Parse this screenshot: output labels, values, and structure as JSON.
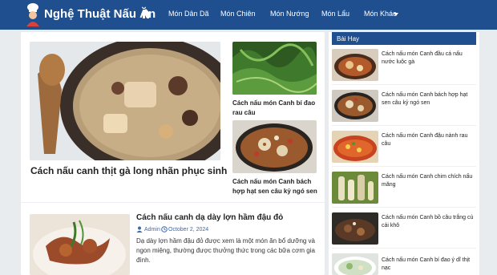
{
  "header": {
    "site_title": "Nghệ Thuật Nấu Ăn",
    "logo_icon": "chef-icon",
    "home_icon": "home-icon",
    "nav": [
      "Món Dân Dã",
      "Món Chiên",
      "Món Nướng",
      "Món Lẩu",
      "Món Khác"
    ],
    "colors": {
      "bar": "#1f4f8f",
      "text": "#ffffff"
    }
  },
  "main": {
    "featured": {
      "title": "Cách nấu canh thịt gà long nhãn phục sinh"
    },
    "side_posts": [
      {
        "title": "Cách nấu món Canh bí đao rau câu"
      },
      {
        "title": "Cách nấu món Canh bách hợp hạt sen câu kỷ ngó sen"
      }
    ],
    "post": {
      "title": "Cách nấu canh dạ dày lợn hầm đậu đỏ",
      "author": "Admin",
      "date": "October 2, 2024",
      "excerpt": "Dạ dày lợn hầm đậu đỏ được xem là một món ăn bổ dưỡng và ngon miệng, thường được thưởng thức trong các bữa cơm gia đình."
    }
  },
  "sidebar": {
    "heading": "Bài Hay",
    "items": [
      {
        "title": "Cách nấu món Canh đầu cá nấu nước luộc gà"
      },
      {
        "title": "Cách nấu món Canh bách hợp hạt sen câu kỷ ngó sen"
      },
      {
        "title": "Cách nấu món Canh đậu nành rau câu"
      },
      {
        "title": "Cách nấu món Canh chim chích nấu măng"
      },
      {
        "title": "Cách nấu món Canh bồ câu trắng củ cải khô"
      },
      {
        "title": "Cách nấu món Canh bí đao ý dĩ thịt nạc"
      }
    ]
  },
  "colors": {
    "accent": "#1f4f8f",
    "meta": "#3a6ab0"
  }
}
